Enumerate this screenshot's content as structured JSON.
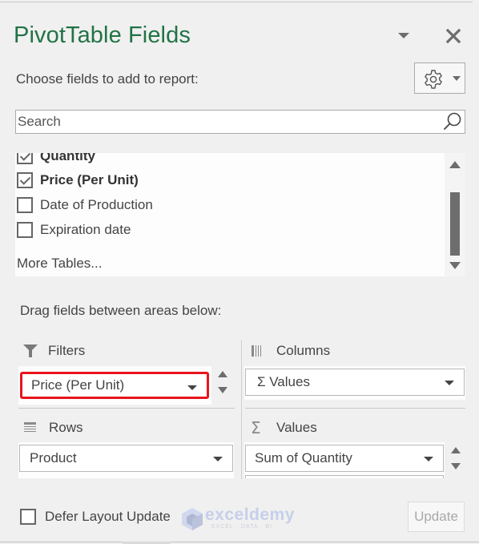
{
  "panel": {
    "title": "PivotTable Fields",
    "subtitle": "Choose fields to add to report:",
    "icons": {
      "collapse": "chevron-down-icon",
      "close": "close-icon",
      "settings": "gear-icon",
      "search": "search-icon"
    }
  },
  "search": {
    "placeholder": "Search",
    "value": ""
  },
  "fields": [
    {
      "label": "Quantity",
      "checked": true,
      "bold": true
    },
    {
      "label": "Price (Per Unit)",
      "checked": true,
      "bold": true
    },
    {
      "label": "Date of Production",
      "checked": false,
      "bold": false
    },
    {
      "label": "Expiration date",
      "checked": false,
      "bold": false
    }
  ],
  "more_tables": "More Tables...",
  "drag_label": "Drag fields between areas below:",
  "areas": {
    "filters": {
      "title": "Filters",
      "icon": "filter-icon",
      "items": [
        "Price (Per Unit)"
      ]
    },
    "columns": {
      "title": "Columns",
      "icon": "columns-icon",
      "items": [
        "Σ Values"
      ]
    },
    "rows": {
      "title": "Rows",
      "icon": "rows-icon",
      "items": [
        "Product"
      ]
    },
    "values": {
      "title": "Values",
      "icon": "sigma-icon",
      "items": [
        "Sum of Quantity"
      ]
    }
  },
  "footer": {
    "defer_label": "Defer Layout Update",
    "defer_checked": false,
    "update_label": "Update"
  },
  "watermark": {
    "name": "exceldemy",
    "tagline": "EXCEL · DATA · BI"
  },
  "colors": {
    "title_green": "#217346",
    "highlight_red": "#e8141c"
  }
}
